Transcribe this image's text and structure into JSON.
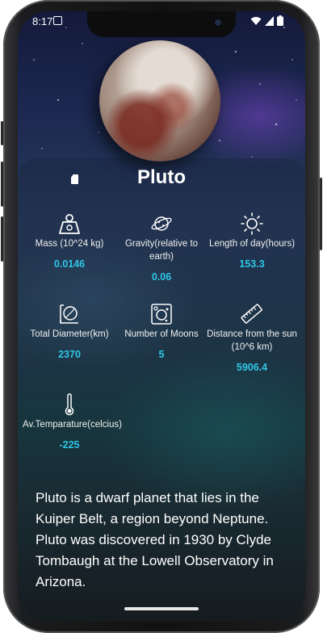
{
  "status_bar": {
    "time": "8:17"
  },
  "planet": {
    "name": "Pluto",
    "description": "Pluto is a dwarf planet that lies in the Kuiper Belt, a region beyond Neptune. Pluto was discovered in 1930 by Clyde Tombaugh at the Lowell Observatory in Arizona."
  },
  "stats": [
    {
      "icon": "weight-icon",
      "label": "Mass (10^24 kg)",
      "value": "0.0146"
    },
    {
      "icon": "gravity-planet-icon",
      "label": "Gravity(relative to earth)",
      "value": "0.06"
    },
    {
      "icon": "sun-icon",
      "label": "Length of day(hours)",
      "value": "153.3"
    },
    {
      "icon": "diameter-icon",
      "label": "Total Diameter(km)",
      "value": "2370"
    },
    {
      "icon": "moons-icon",
      "label": "Number of Moons",
      "value": "5"
    },
    {
      "icon": "ruler-icon",
      "label": "Distance from the sun (10^6 km)",
      "value": "5906.4"
    },
    {
      "icon": "thermometer-icon",
      "label": "Av.Temparature(celcius)",
      "value": "-225"
    }
  ],
  "colors": {
    "accent": "#2ec6e6",
    "text": "#ffffff"
  }
}
